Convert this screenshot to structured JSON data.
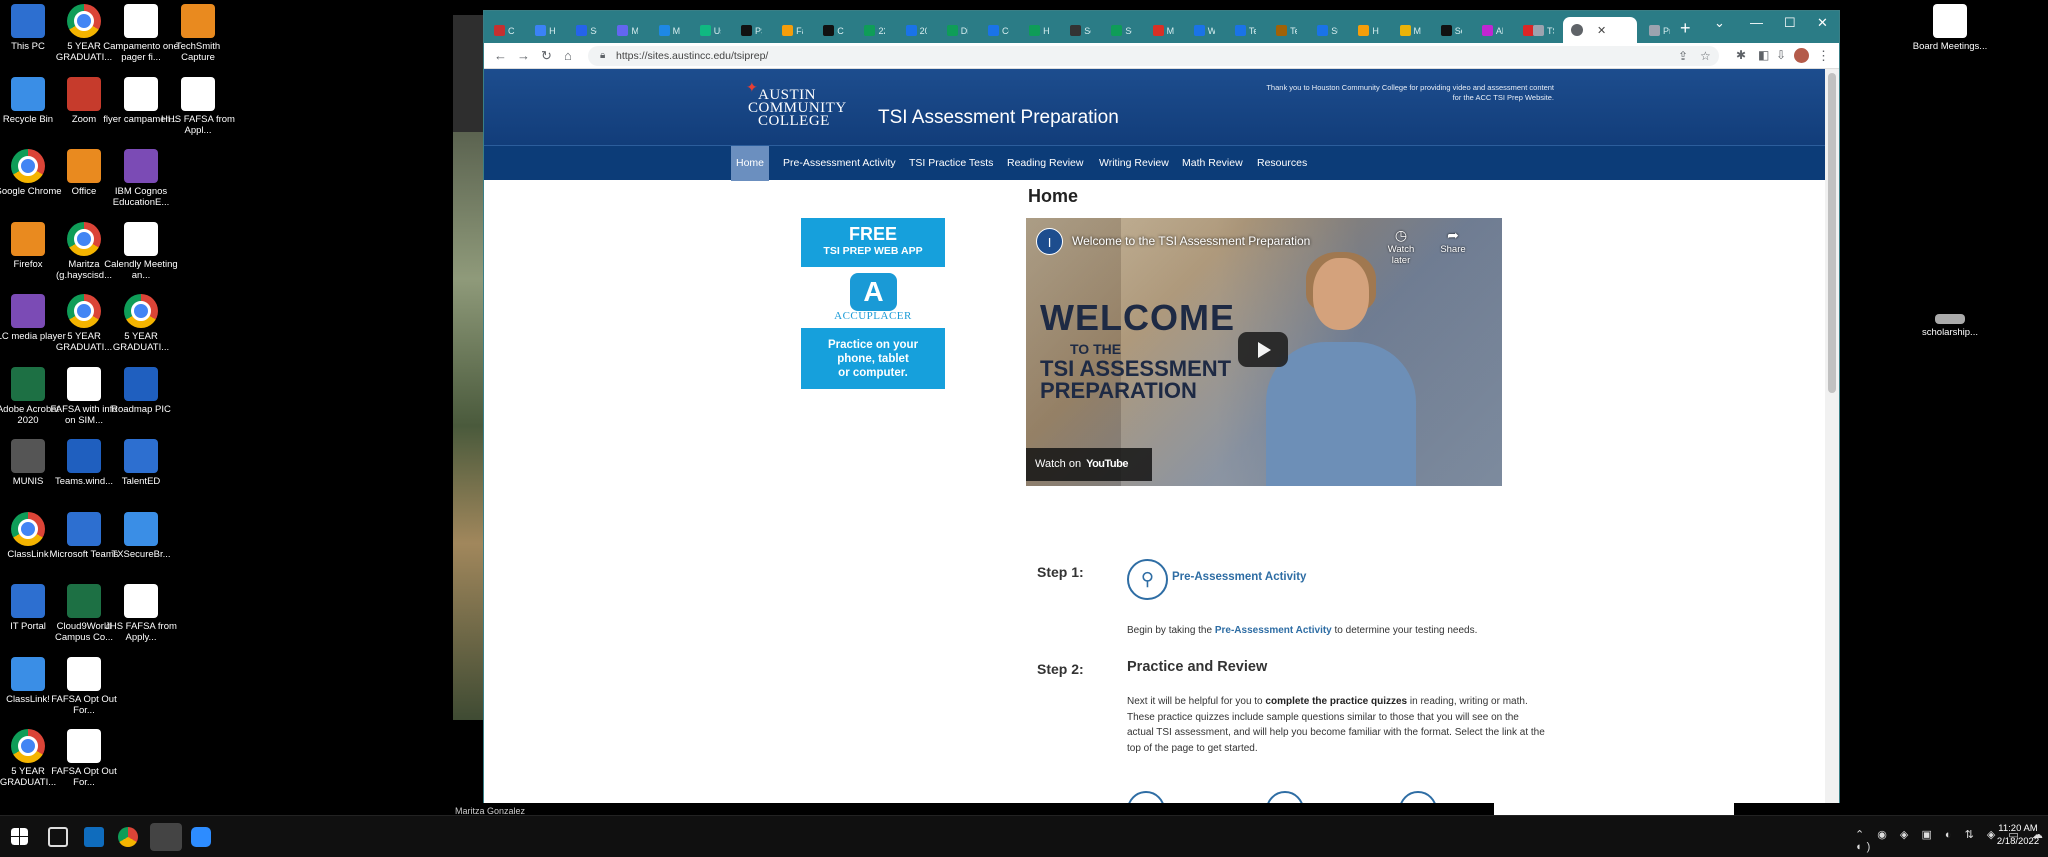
{
  "desktop": {
    "icons_col1": [
      "This PC",
      "Recycle Bin",
      "Google Chrome",
      "Firefox",
      "VLC media player",
      "Adobe Acrobat 2020",
      "MUNIS",
      "ClassLink",
      "IT Portal",
      "ClassLink!",
      "5 YEAR GRADUATI..."
    ],
    "icons_col2": [
      "5 YEAR GRADUATI...",
      "Zoom",
      "Office",
      "Maritza (g.hayscisd...",
      "5 YEAR GRADUATI...",
      "FAFSA with info on SIM...",
      "Teams.wind...",
      "Microsoft Teams",
      "Cloud9World Campus Co...",
      "FAFSA Opt Out For...",
      "FAFSA Opt Out For..."
    ],
    "icons_col3": [
      "Campamento one pager fi...",
      "flyer campamen...",
      "IBM Cognos EducationE...",
      "Calendly Meeting an...",
      "5 YEAR GRADUATI...",
      "Roadmap PIC",
      "TalentED",
      "TXSecureBr...",
      "JHS FAFSA from Apply..."
    ],
    "icons_col4": [
      "TechSmith Capture",
      "HHS FAFSA from Appl..."
    ],
    "right_icons": [
      "Board Meetings...",
      "scholarship..."
    ]
  },
  "browser": {
    "tabs": [
      "Cl",
      "Ha",
      "Sc",
      "Mi",
      "M",
      "Us",
      "PS",
      "Fa",
      "Co",
      "22",
      "20",
      "Di",
      "Co",
      "Ho",
      "Sc",
      "Sc",
      "Mi",
      "W",
      "Te",
      "Te",
      "Su",
      "Ha",
      "M",
      "Sc",
      "Al",
      "Ti",
      "TS",
      "Pr"
    ],
    "active_tab": "",
    "url": "https://sites.austincc.edu/tsiprep/"
  },
  "site": {
    "logo": {
      "line1": "AUSTIN",
      "line2": "COMMUNITY",
      "line3": "COLLEGE"
    },
    "title": "TSI Assessment Preparation",
    "header_note": "Thank you to Houston Community College for providing video and assessment content for the ACC TSI Prep Website.",
    "nav": [
      "Home",
      "Pre-Assessment Activity",
      "TSI Practice Tests",
      "Reading Review",
      "Writing Review",
      "Math Review",
      "Resources"
    ],
    "page_title": "Home"
  },
  "ad": {
    "free": "FREE",
    "subtitle": "TSI PREP WEB APP",
    "brand": "ACCUPLACER",
    "practice": "Practice on your\nphone, tablet\nor computer."
  },
  "video": {
    "title": "Welcome to the TSI Assessment Preparation",
    "watch_later": "Watch later",
    "share": "Share",
    "welcome_1": "WELCOME",
    "welcome_2": "TO THE",
    "welcome_3": "TSI ASSESSMENT",
    "welcome_4": "PREPARATION",
    "watch_on": "Watch on",
    "youtube": "YouTube"
  },
  "steps": {
    "step1_label": "Step 1:",
    "step1_link": "Pre-Assessment Activity",
    "step1_text_before": "Begin by taking the ",
    "step1_text_link": "Pre-Assessment Activity",
    "step1_text_after": " to determine your testing needs.",
    "step2_label": "Step 2:",
    "step2_heading": "Practice and Review",
    "step2_before": "Next it will be helpful for you to ",
    "step2_bold": "complete the practice quizzes",
    "step2_after": " in reading, writing or math. These practice quizzes include sample questions similar to those that you will see on the actual TSI assessment, and will help you become familiar with the format. Select the link at the top of the page to get started."
  },
  "status": {
    "user": "Maritza Gonzalez"
  },
  "taskbar": {
    "time": "11:20 AM",
    "date": "2/18/2022"
  },
  "colors": {
    "header_blue": "#1d4d8e",
    "nav_blue": "#0c3c78",
    "link_blue": "#2e6da4",
    "ad_cyan": "#16a0dc",
    "tab_teal": "#2b7c86"
  }
}
